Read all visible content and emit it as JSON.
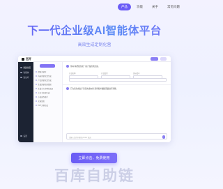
{
  "nav": {
    "items": [
      "产品",
      "功能",
      "关于",
      "常见问题"
    ],
    "active_index": 0
  },
  "hero": {
    "title": "下一代企业级AI智能体平台",
    "subtitle": "高效生成定制化营"
  },
  "app": {
    "logo_text": "百开",
    "sidebar": [
      "新建对话",
      "智能体",
      "知识库",
      "设置"
    ],
    "list_items": [
      "提取关键字",
      "内容营销文案生成",
      "产品营销文案生成",
      "生成营销活动策划",
      "生成小红书种草文案",
      "小红书文案生成",
      "小说创作助手",
      "文章润色",
      "PPT大纲生成"
    ],
    "messages": [
      "你好!请帮我生成一段产品营销文案。",
      "已为您生成如下营销文案内容,请查看并根据需要进行调整。"
    ],
    "chip_labels": [
      "产品名称",
      "产品类型",
      "目标受众"
    ],
    "input_placeholder": "请输入您的问题,按 Enter 发送"
  },
  "cta": {
    "label": "立即点击，免费使用"
  },
  "watermark": "百库自助链",
  "colors": {
    "accent": "#6b5cf6",
    "sidebar_bg": "#1c2333"
  }
}
